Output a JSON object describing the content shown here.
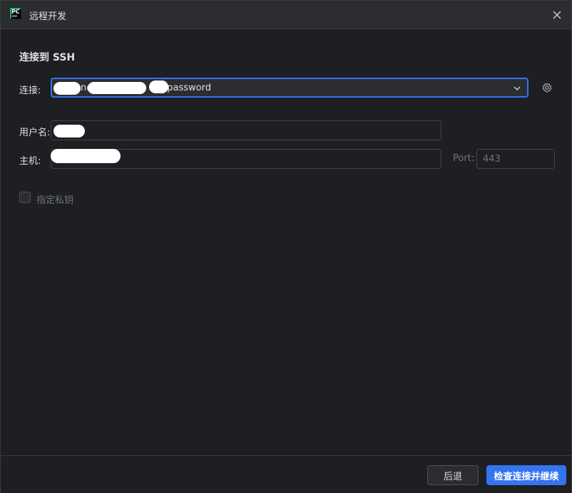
{
  "window": {
    "title": "远程开发",
    "logo_text": "PC"
  },
  "heading": "连接到 SSH",
  "connection": {
    "label": "连接:",
    "value_visible": "n@",
    "value_suffix": "password"
  },
  "username": {
    "label": "用户名:",
    "value": ""
  },
  "host": {
    "label": "主机:",
    "value": "",
    "port_label": "Port:",
    "port_placeholder": "443"
  },
  "private_key": {
    "label": "指定私钥",
    "checked": false
  },
  "footer": {
    "back_label": "后退",
    "next_label": "检查连接并继续"
  },
  "colors": {
    "accent": "#3574f0",
    "background": "#1e1f22",
    "panel": "#2b2d30"
  },
  "icons": {
    "close": "close-icon",
    "dropdown": "chevron-down-icon",
    "settings": "gear-icon"
  }
}
